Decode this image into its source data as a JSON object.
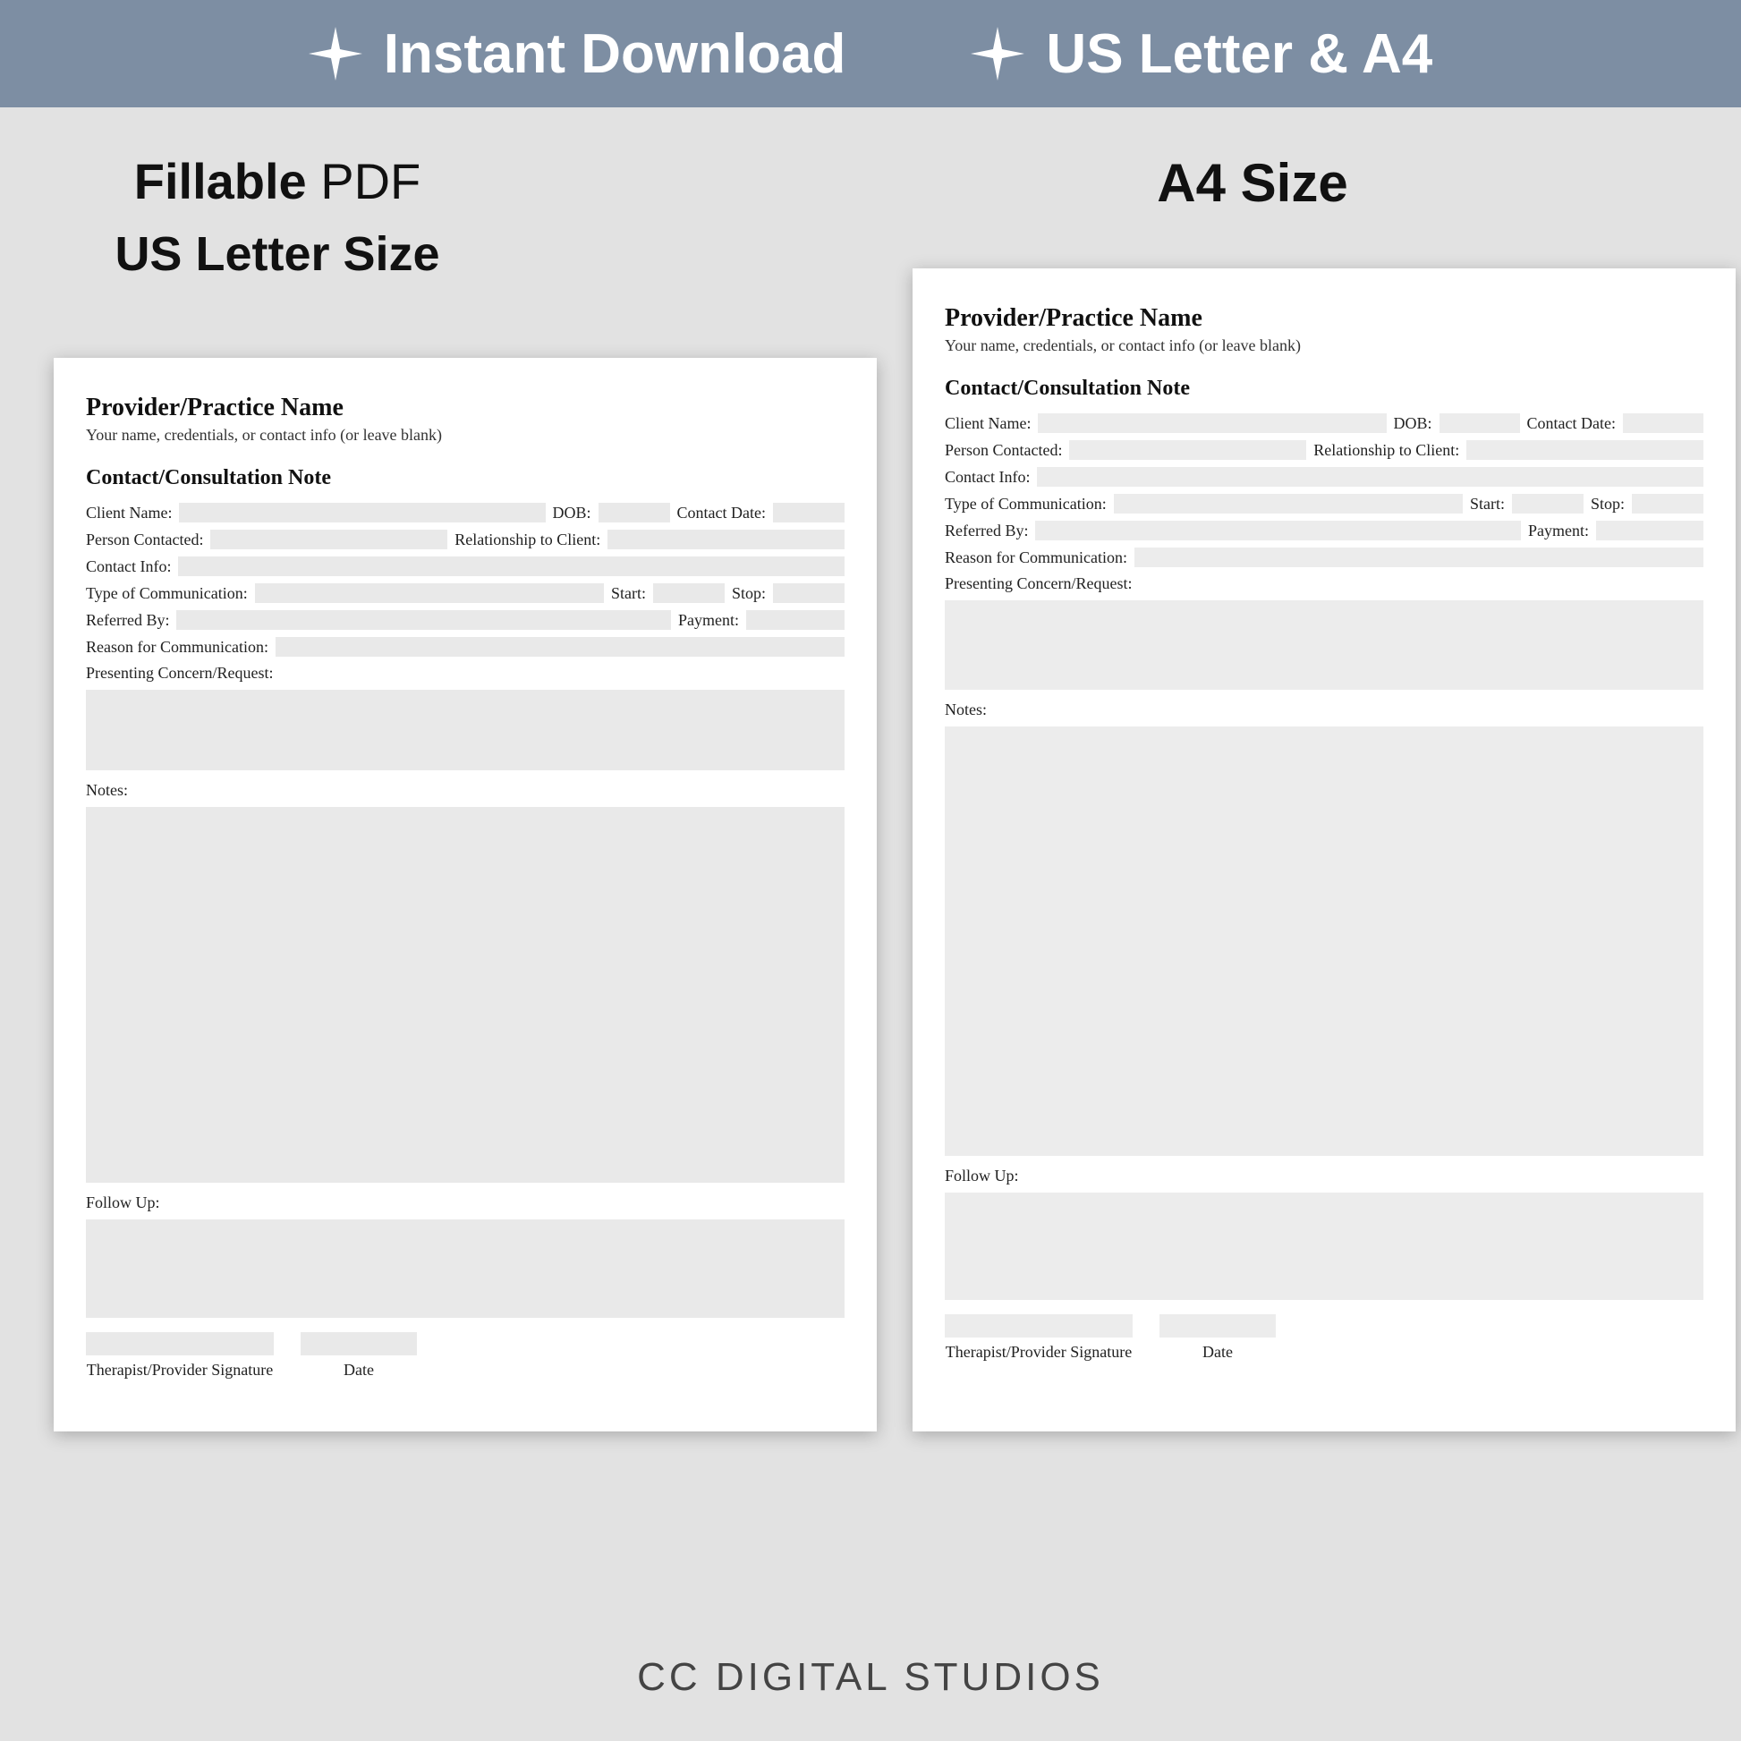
{
  "banner": {
    "item1": "Instant Download",
    "item2": "US Letter & A4"
  },
  "labels": {
    "left_line1_bold": "Fillable",
    "left_line1_rest": " PDF",
    "left_line2": "US Letter Size",
    "right": "A4 Size"
  },
  "form": {
    "heading": "Provider/Practice Name",
    "subheading": "Your name, credentials, or contact info (or leave blank)",
    "section_title": "Contact/Consultation Note",
    "fields": {
      "client_name": "Client Name:",
      "dob": "DOB:",
      "contact_date": "Contact Date:",
      "person_contacted": "Person Contacted:",
      "relationship": "Relationship to Client:",
      "contact_info": "Contact Info:",
      "type_comm": "Type of Communication:",
      "start": "Start:",
      "stop": "Stop:",
      "referred_by": "Referred By:",
      "payment": "Payment:",
      "reason": "Reason for Communication:",
      "presenting": "Presenting Concern/Request:",
      "notes": "Notes:",
      "follow_up": "Follow Up:",
      "sig": "Therapist/Provider Signature",
      "date": "Date"
    }
  },
  "footer": "CC DIGITAL STUDIOS"
}
